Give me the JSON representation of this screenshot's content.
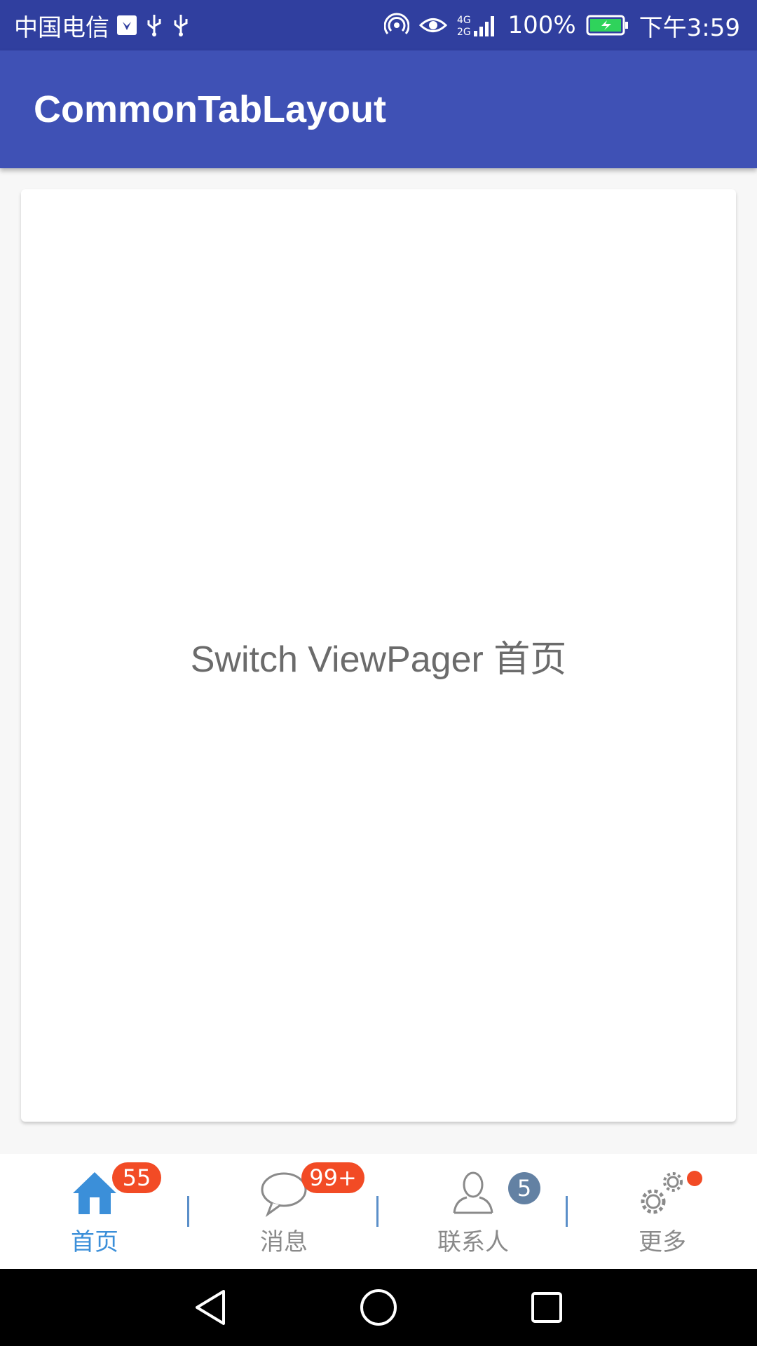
{
  "status_bar": {
    "carrier": "中国电信",
    "battery": "100%",
    "time": "下午3:59",
    "network": "4G 2G",
    "icons": [
      "huawei-icon",
      "usb-icon",
      "usb-icon",
      "hotspot-icon",
      "eye-icon",
      "signal-icon",
      "battery-charging-icon"
    ]
  },
  "app_bar": {
    "title": "CommonTabLayout"
  },
  "content": {
    "text": "Switch ViewPager 首页"
  },
  "tabs": [
    {
      "label": "首页",
      "icon": "home-icon",
      "badge": "55",
      "active": true
    },
    {
      "label": "消息",
      "icon": "chat-bubble-icon",
      "badge": "99+",
      "active": false
    },
    {
      "label": "联系人",
      "icon": "contact-person-icon",
      "badge": "5",
      "active": false
    },
    {
      "label": "更多",
      "icon": "gears-icon",
      "badge_dot": true,
      "active": false
    }
  ],
  "colors": {
    "status_bar": "#303f9f",
    "app_bar": "#3f51b5",
    "tab_active": "#3b8fd9",
    "tab_inactive": "#8a8a8a",
    "badge_red": "#f24b25",
    "badge_blue": "#6381a3"
  },
  "nav_bar": {
    "icons": [
      "back-icon",
      "home-circle-icon",
      "recents-icon"
    ]
  }
}
